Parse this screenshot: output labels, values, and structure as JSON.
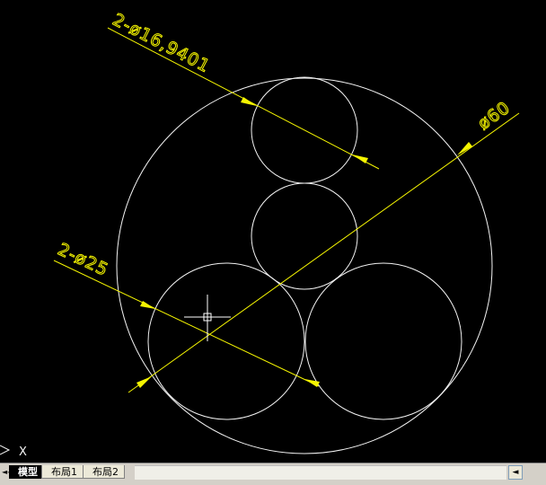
{
  "drawing": {
    "dimensions": {
      "small_circles": "2-ø16,9401",
      "outer_circle": "ø60",
      "large_circles": "2-ø25"
    },
    "ucs_label": "X",
    "colors": {
      "background": "#000000",
      "geometry": "#f4f4f4",
      "dimension": "#f5f500"
    }
  },
  "tabs": {
    "nav_first": "◄◄",
    "nav_prev": "◄",
    "nav_next": "►",
    "nav_last": "►►",
    "model": "模型",
    "layout1": "布局1",
    "layout2": "布局2"
  },
  "scrollbar": {
    "left_arrow": "◄"
  }
}
